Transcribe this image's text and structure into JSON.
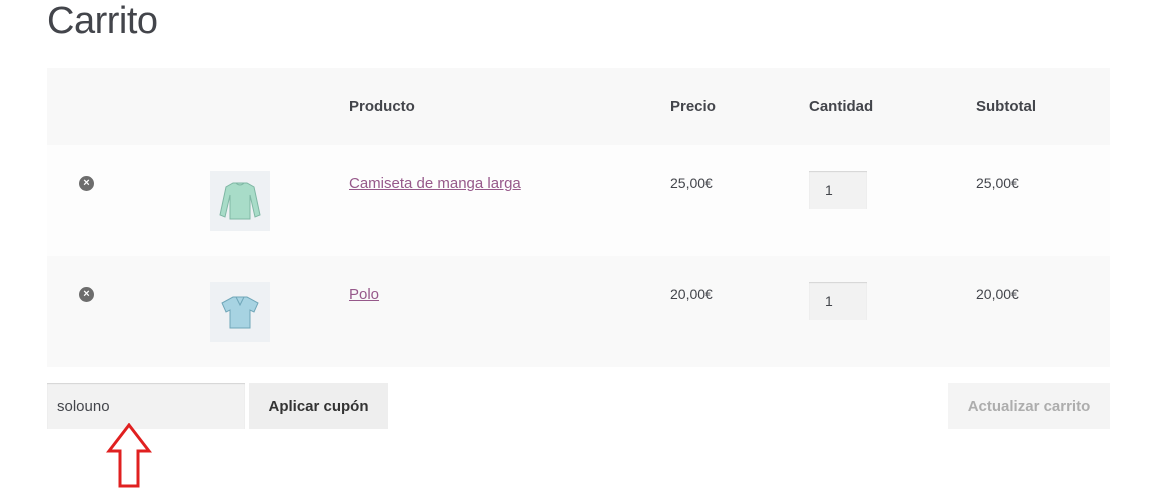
{
  "page": {
    "title": "Carrito"
  },
  "table": {
    "headers": {
      "product": "Producto",
      "price": "Precio",
      "quantity": "Cantidad",
      "subtotal": "Subtotal"
    },
    "rows": [
      {
        "remove": "×",
        "name": "Camiseta de manga larga",
        "price": "25,00€",
        "quantity": "1",
        "subtotal": "25,00€",
        "thumb": "longsleeve-shirt-icon"
      },
      {
        "remove": "×",
        "name": "Polo",
        "price": "20,00€",
        "quantity": "1",
        "subtotal": "20,00€",
        "thumb": "polo-shirt-icon"
      }
    ]
  },
  "coupon": {
    "value": "solouno",
    "apply_label": "Aplicar cupón"
  },
  "update_label": "Actualizar carrito",
  "footer_partial": "...",
  "colors": {
    "link": "#96588a",
    "arrow": "#e02020"
  }
}
